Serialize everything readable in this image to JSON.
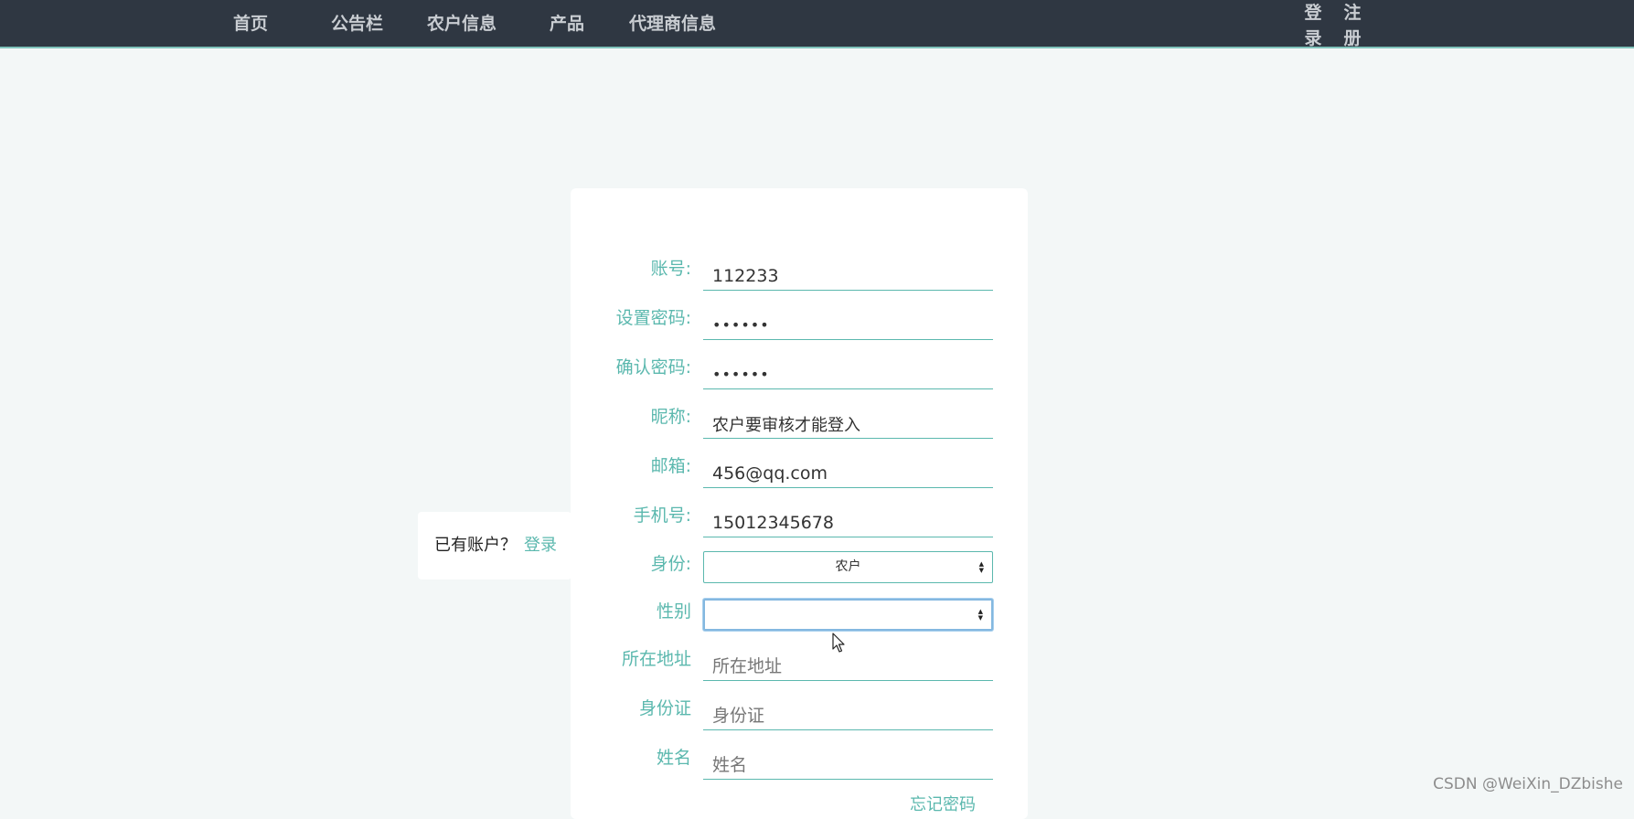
{
  "nav": {
    "items": [
      "首页",
      "公告栏",
      "农户信息",
      "产品",
      "代理商信息"
    ],
    "login": "登录",
    "register": "注册"
  },
  "login_hint": {
    "question": "已有账户？",
    "link": "登录"
  },
  "form": {
    "account": {
      "label": "账号:",
      "value": "112233"
    },
    "password": {
      "label": "设置密码:",
      "value": "••••••"
    },
    "confirm_password": {
      "label": "确认密码:",
      "value": "••••••"
    },
    "nickname": {
      "label": "昵称:",
      "value": "农户要审核才能登入"
    },
    "email": {
      "label": "邮箱:",
      "value": "456@qq.com"
    },
    "phone": {
      "label": "手机号:",
      "value": "15012345678"
    },
    "role": {
      "label": "身份:",
      "selected": "农户"
    },
    "gender": {
      "label": "性别",
      "selected": ""
    },
    "address": {
      "label": "所在地址",
      "placeholder": "所在地址"
    },
    "id_card": {
      "label": "身份证",
      "placeholder": "身份证"
    },
    "name": {
      "label": "姓名",
      "placeholder": "姓名"
    },
    "forgot": "忘记密码"
  },
  "watermark": "CSDN @WeiXin_DZbishe",
  "colors": {
    "nav_bg": "#2f3742",
    "accent": "#5bb8ae",
    "page_bg": "#f3f7f7"
  }
}
